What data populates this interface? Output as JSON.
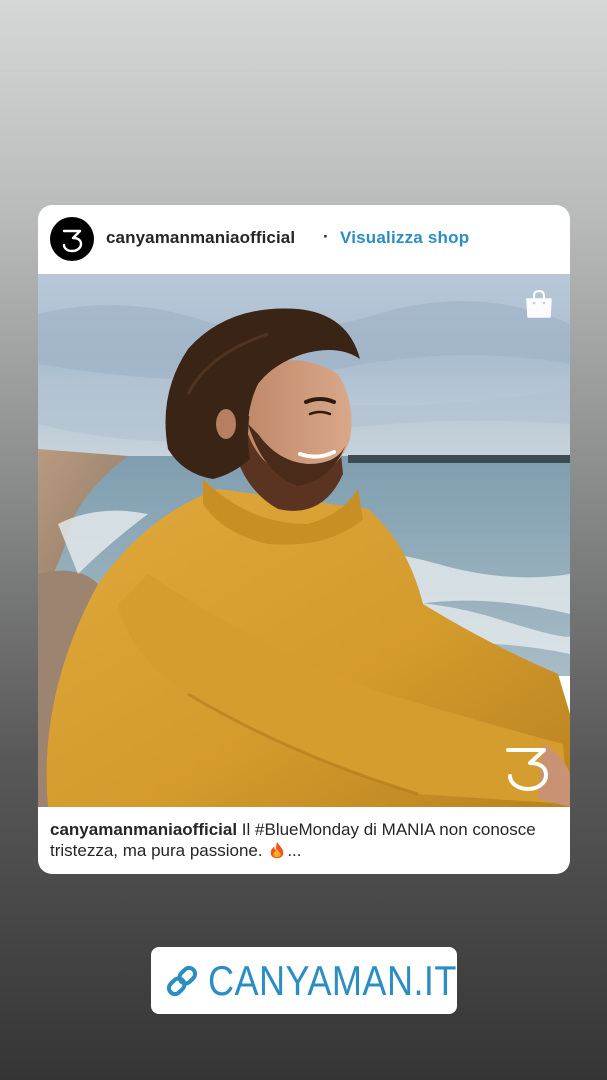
{
  "post": {
    "username": "canyamanmaniaofficial",
    "separator": "·",
    "shop_link_label": "Visualizza shop",
    "caption_username": "canyamanmaniaofficial",
    "caption_text": " Il #BlueMonday di MANIA non conosce tristezza, ma pura passione. ",
    "caption_more": "...",
    "image_icons": [
      "shopping-bag-icon",
      "brand-logo-watermark"
    ]
  },
  "link_sticker": {
    "label": "CANYAMAN.IT",
    "icon": "link-icon"
  },
  "colors": {
    "accent_blue": "#2a8ec4",
    "text_dark": "#262626",
    "card_bg": "#ffffff",
    "sweater_yellow": "#d9a030"
  }
}
